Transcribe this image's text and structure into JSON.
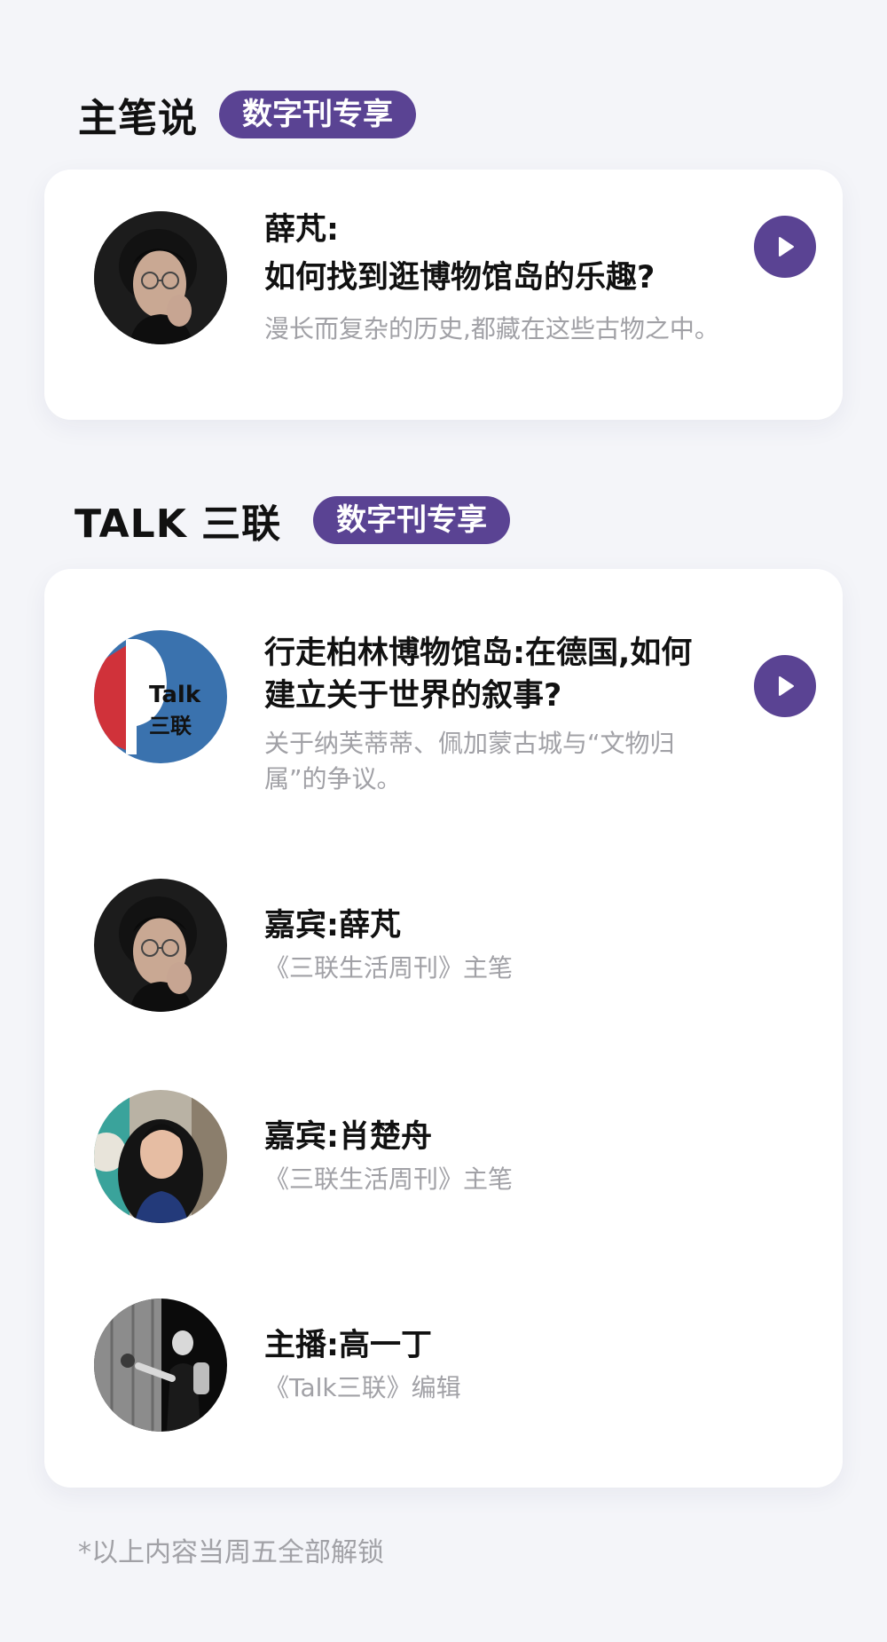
{
  "section1": {
    "title": "主笔说",
    "badge": "数字刊专享",
    "card": {
      "title_line1": "薛芃:",
      "title_line2": "如何找到逛博物馆岛的乐趣?",
      "description": "漫长而复杂的历史,都藏在这些古物之中。"
    }
  },
  "section2": {
    "title": "TALK 三联",
    "badge": "数字刊专享",
    "episode": {
      "logo_line1": "Talk",
      "logo_line2": "三联",
      "title": "行走柏林博物馆岛:在德国,如何建立关于世界的叙事?",
      "description": "关于纳芙蒂蒂、佩加蒙古城与“文物归属”的争议。"
    },
    "people": [
      {
        "name": "嘉宾:薛芃",
        "role": "《三联生活周刊》主笔"
      },
      {
        "name": "嘉宾:肖楚舟",
        "role": "《三联生活周刊》主笔"
      },
      {
        "name": "主播:高一丁",
        "role": "《Talk三联》编辑"
      }
    ]
  },
  "footnote": "*以上内容当周五全部解锁",
  "colors": {
    "accent": "#5a4393",
    "background": "#f4f5f9",
    "muted_text": "#a1a1a6",
    "logo_blue": "#3a72ae",
    "logo_red": "#d0323a"
  },
  "icons": {
    "play": "play-icon"
  }
}
